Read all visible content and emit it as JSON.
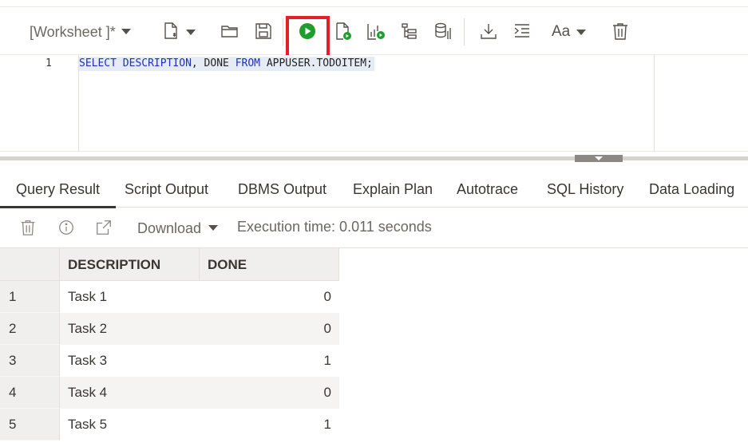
{
  "toolbar": {
    "worksheet_name": "[Worksheet ]*",
    "font_label": "Aa",
    "run_highlight_color": "#e3202a",
    "run_icon_color": "#1f9d2e",
    "icons": [
      "new-file-icon",
      "open-folder-icon",
      "save-icon",
      "run-statement-icon",
      "run-script-icon",
      "autotrace-icon",
      "explain-plan-icon",
      "sql-tuning-icon",
      "download-icon",
      "format-icon",
      "font-icon",
      "clear-icon"
    ]
  },
  "editor": {
    "line_number": "1",
    "code_tokens": [
      {
        "text": "SELECT",
        "kw": true
      },
      {
        "text": " ",
        "kw": false
      },
      {
        "text": "DESCRIPTION",
        "kw": true
      },
      {
        "text": ", ",
        "kw": false
      },
      {
        "text": "DONE",
        "kw": false
      },
      {
        "text": " ",
        "kw": false
      },
      {
        "text": "FROM",
        "kw": true
      },
      {
        "text": " APPUSER.TODOITEM;",
        "kw": false
      }
    ]
  },
  "tabs": [
    {
      "label": "Query Result",
      "active": true
    },
    {
      "label": "Script Output",
      "active": false
    },
    {
      "label": "DBMS Output",
      "active": false
    },
    {
      "label": "Explain Plan",
      "active": false
    },
    {
      "label": "Autotrace",
      "active": false
    },
    {
      "label": "SQL History",
      "active": false
    },
    {
      "label": "Data Loading",
      "active": false
    }
  ],
  "result_toolbar": {
    "download_label": "Download",
    "execution_time": "Execution time: 0.011 seconds"
  },
  "grid": {
    "columns": [
      "DESCRIPTION",
      "DONE"
    ],
    "rows": [
      {
        "num": "1",
        "description": "Task 1",
        "done": "0"
      },
      {
        "num": "2",
        "description": "Task 2",
        "done": "0"
      },
      {
        "num": "3",
        "description": "Task 3",
        "done": "1"
      },
      {
        "num": "4",
        "description": "Task 4",
        "done": "0"
      },
      {
        "num": "5",
        "description": "Task 5",
        "done": "1"
      }
    ]
  }
}
